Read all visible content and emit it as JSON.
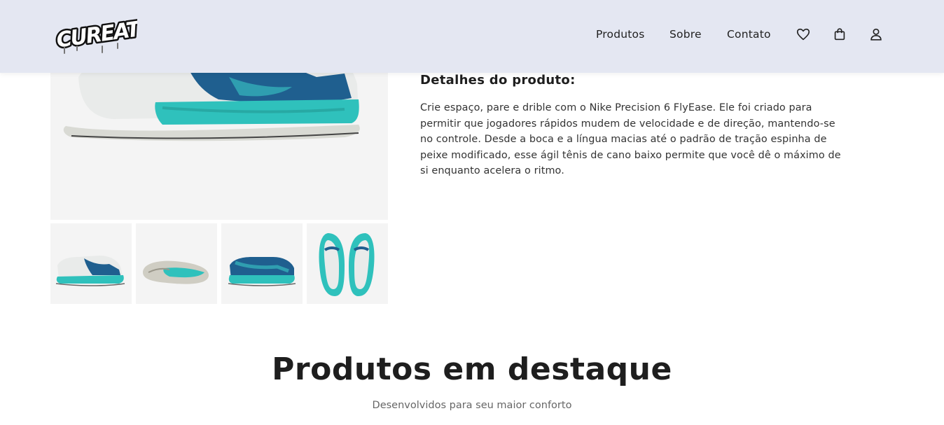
{
  "header": {
    "logo_text": "CUREATE",
    "nav": [
      {
        "label": "Produtos"
      },
      {
        "label": "Sobre"
      },
      {
        "label": "Contato"
      }
    ],
    "icons": [
      "heart-icon",
      "shopping-bag-icon",
      "user-icon"
    ]
  },
  "product": {
    "details_title": "Detalhes do produto:",
    "details_text": "Crie espaço, pare e drible com o Nike Precision 6 FlyEase. Ele foi criado para permitir que jogadores rápidos mudem de velocidade e de direção, mantendo-se no controle. Desde a boca e a língua macias até o padrão de tração espinha de peixe modificado, esse ágil tênis de cano baixo permite que você dê o máximo de si enquanto acelera o ritmo.",
    "colors": {
      "teal": "#2fc1bc",
      "blue": "#1f5f8f",
      "sole": "#e8e8e4"
    }
  },
  "featured": {
    "title": "Produtos em destaque",
    "subtitle": "Desenvolvidos para seu maior conforto"
  }
}
